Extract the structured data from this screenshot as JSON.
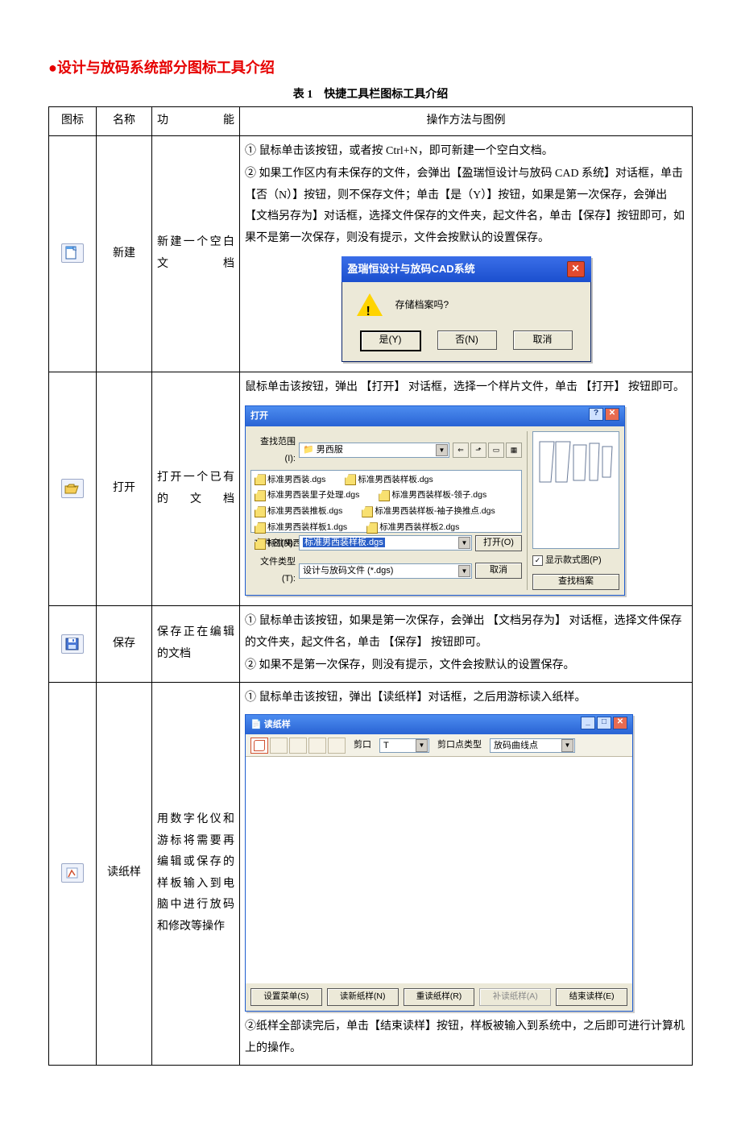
{
  "heading": "●设计与放码系统部分图标工具介绍",
  "caption": "表 1　快捷工具栏图标工具介绍",
  "header": {
    "icon": "图标",
    "name": "名称",
    "func": "功能",
    "desc": "操作方法与图例"
  },
  "rows": [
    {
      "name": "新建",
      "func": "新建一个空白文档",
      "desc1": "① 鼠标单击该按钮，或者按 Ctrl+N，即可新建一个空白文档。",
      "desc2": "② 如果工作区内有未保存的文件，会弹出【盈瑞恒设计与放码 CAD 系统】对话框，单击【否（N）】按钮，则不保存文件；单击【是（Y）】按钮，如果是第一次保存，会弹出【文档另存为】对话框，选择文件保存的文件夹，起文件名，单击【保存】按钮即可，如果不是第一次保存，则没有提示，文件会按默认的设置保存。",
      "dialog": {
        "title": "盈瑞恒设计与放码CAD系统",
        "message": "存储档案吗?",
        "yes": "是(Y)",
        "no": "否(N)",
        "cancel": "取消"
      }
    },
    {
      "name": "打开",
      "func": "打开一个已有的文档",
      "desc1": "鼠标单击该按钮，弹出 【打开】 对话框，选择一个样片文件，单击 【打开】 按钮即可。",
      "dialog": {
        "title": "打开",
        "lookIn": "查找范围(I):",
        "folder": "男西服",
        "files": [
          "标准男西装.dgs",
          "标准男西装里子处理.dgs",
          "标准男西装推板.dgs",
          "标准男西装样板1.dgs",
          "标准男西装样板2.dgs",
          "标准男西装样板3.dgs",
          "标准男西装样板.dgs",
          "标准男西装样板-领子.dgs",
          "标准男西装样板-袖子换推点.dgs"
        ],
        "fileNameLabel": "文件名(N):",
        "selected": "标准男西装样板.dgs",
        "fileTypeLabel": "文件类型(T):",
        "fileType": "设计与放码文件 (*.dgs)",
        "openBtn": "打开(O)",
        "cancelBtn": "取消",
        "showPreview": "显示款式图(P)",
        "searchBtn": "查找档案"
      }
    },
    {
      "name": "保存",
      "func": "保存正在编辑的文档",
      "desc1": "① 鼠标单击该按钮，如果是第一次保存，会弹出 【文档另存为】 对话框，选择文件保存的文件夹，起文件名，单击 【保存】 按钮即可。",
      "desc2": "② 如果不是第一次保存，则没有提示，文件会按默认的设置保存。"
    },
    {
      "name": "读纸样",
      "func": "用数字化仪和游标将需要再编辑或保存的样板输入到电脑中进行放码和修改等操作",
      "desc1": "① 鼠标单击该按钮，弹出【读纸样】对话框，之后用游标读入纸样。",
      "desc2": "②纸样全部读完后，单击【结束读样】按钮，样板被输入到系统中，之后即可进行计算机上的操作。",
      "dialog": {
        "title": "读纸样",
        "cutLabel": "剪口",
        "cutValue": "T",
        "pointTypeLabel": "剪口点类型",
        "pointTypeValue": "放码曲线点",
        "btn1": "设置菜单(S)",
        "btn2": "读新纸样(N)",
        "btn3": "重读纸样(R)",
        "btn4": "补读纸样(A)",
        "btn5": "结束读样(E)"
      }
    }
  ]
}
